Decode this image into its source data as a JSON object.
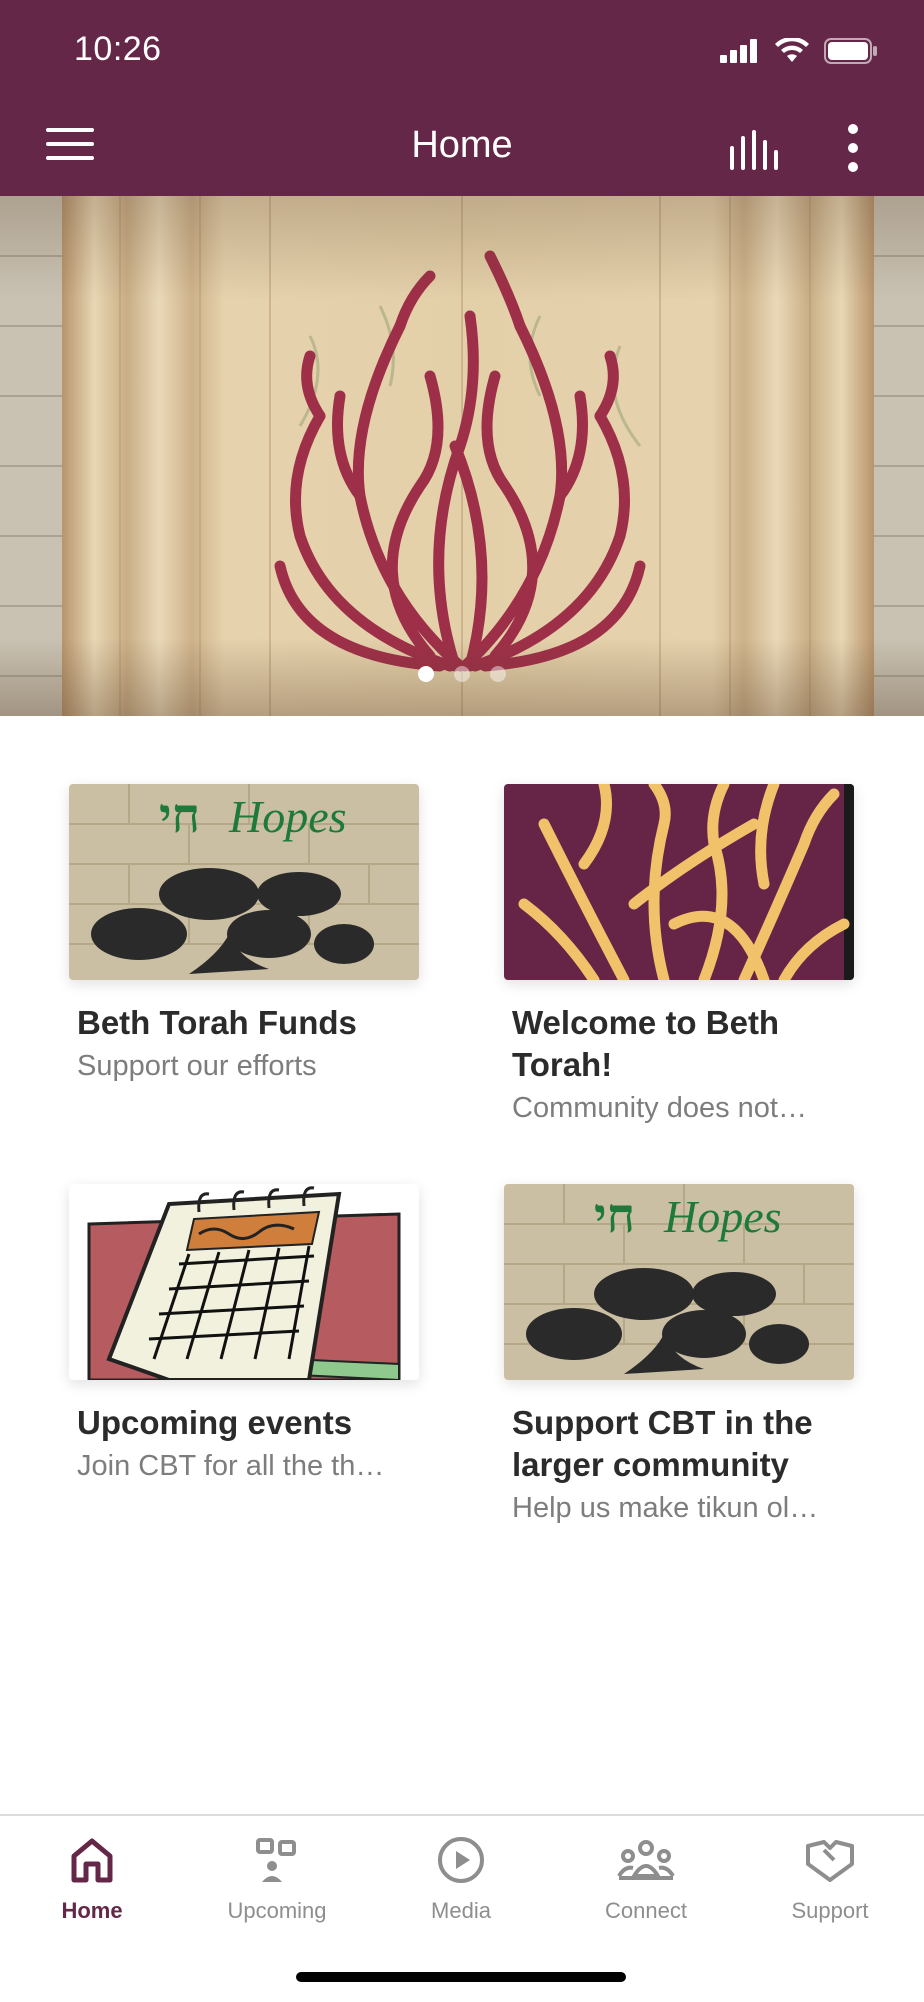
{
  "status": {
    "time": "10:26"
  },
  "header": {
    "title": "Home",
    "bg_color": "#652747"
  },
  "icons": {
    "menu": "hamburger-icon",
    "stats": "equalizer-icon",
    "more": "vertical-dots-icon"
  },
  "carousel": {
    "pages": 3,
    "active_index": 0
  },
  "cards": [
    {
      "title": "Beth Torah Funds",
      "subtitle": "Support our efforts",
      "image": "chai-hopes-logo"
    },
    {
      "title": "Welcome to Beth Torah!",
      "subtitle": "Community does not…",
      "image": "burning-bush-art"
    },
    {
      "title": "Upcoming events",
      "subtitle": "Join CBT for all the th…",
      "image": "calendar-clipart"
    },
    {
      "title": "Support CBT in the larger community",
      "subtitle": "Help us make tikun ol…",
      "image": "chai-hopes-logo"
    }
  ],
  "chai_logo_text": "Hopes",
  "tabs": [
    {
      "label": "Home",
      "icon": "home-icon",
      "active": true
    },
    {
      "label": "Upcoming",
      "icon": "upcoming-icon",
      "active": false
    },
    {
      "label": "Media",
      "icon": "play-circle-icon",
      "active": false
    },
    {
      "label": "Connect",
      "icon": "people-icon",
      "active": false
    },
    {
      "label": "Support",
      "icon": "handshake-icon",
      "active": false
    }
  ],
  "colors": {
    "accent": "#652747",
    "inactive": "#8e8e8e"
  }
}
